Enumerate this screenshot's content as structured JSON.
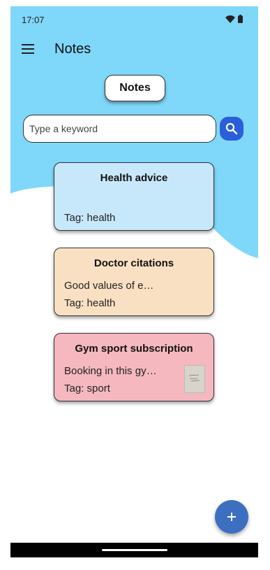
{
  "status_bar": {
    "time": "17:07",
    "icons": [
      "wifi-icon",
      "battery-icon"
    ]
  },
  "app_bar": {
    "menu_icon": "menu-icon",
    "title": "Notes"
  },
  "header_chip": {
    "label": "Notes"
  },
  "search": {
    "placeholder": "Type a keyword",
    "value": "",
    "button_icon": "search-icon"
  },
  "notes": [
    {
      "title": "Health advice",
      "preview": "",
      "tag": "Tag: health",
      "color": "#c7e8fb",
      "has_image": false
    },
    {
      "title": "Doctor citations",
      "preview": "Good values of e…",
      "tag": "Tag: health",
      "color": "#fae0c2",
      "has_image": false
    },
    {
      "title": "Gym sport subscription",
      "preview": "Booking in this gy…",
      "tag": "Tag: sport",
      "color": "#f5b8bf",
      "has_image": true
    }
  ],
  "fab": {
    "icon": "plus-icon"
  },
  "colors": {
    "header_bg": "#7fd7fa",
    "accent": "#2b5fd9",
    "fab": "#3d6fc1"
  }
}
